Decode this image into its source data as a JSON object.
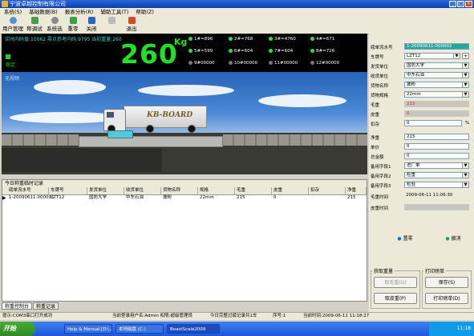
{
  "window": {
    "title": "宁波卓越控制有限公司"
  },
  "menu": [
    "系统(S)",
    "基础数据(B)",
    "报表分析(R)",
    "辅助工具(T)",
    "帮助(Z)"
  ],
  "toolbar": [
    "用户管理",
    "称调试",
    "系统选项",
    "重零",
    "关闭",
    "",
    "退出"
  ],
  "display": {
    "info": "实时内码值:10062 零点参考内码:9795  当前重量:260",
    "weight": "260",
    "unit": "Kg",
    "stable": "稳定",
    "io": [
      {
        "label": "1#=896",
        "on": true
      },
      {
        "label": "2#=768",
        "on": true
      },
      {
        "label": "3#=4760",
        "on": true
      },
      {
        "label": "4#=671",
        "on": true
      },
      {
        "label": "5#=599",
        "on": true
      },
      {
        "label": "6#=604",
        "on": true
      },
      {
        "label": "7#=604",
        "on": true
      },
      {
        "label": "8#=726",
        "on": true
      },
      {
        "label": "9#00000",
        "on": false
      },
      {
        "label": "10#00000",
        "on": false
      },
      {
        "label": "11#00000",
        "on": false
      },
      {
        "label": "12#00000",
        "on": false
      }
    ]
  },
  "video": {
    "camera_label": "无视频",
    "truck_text": "KB-BOARD"
  },
  "records": {
    "title": "今日称重临时记录",
    "columns": [
      "磅单流水号",
      "车牌号",
      "发货单位",
      "收货单位",
      "货物名称",
      "规格",
      "毛重",
      "皮重",
      "扣杂",
      "净重"
    ],
    "rows": [
      [
        "1-20090611-000001",
        "LZT12",
        "国防大学",
        "中东石油",
        "玻粉",
        "22mm",
        "215",
        "0",
        "",
        "215"
      ]
    ]
  },
  "bottom_tabs": [
    "称重控制台",
    "称重记录"
  ],
  "statusbar": [
    "提示:COM3串口打开成功",
    "当前登录用户名:Admin 权限:超级管理员",
    "今日完整过磅记录共1车",
    "序号:1",
    "当前时间:2009-06-11 11:18:27"
  ],
  "taskbar": {
    "start": "开始",
    "tasks": [
      "Help & Manual [D:\\...",
      "本地磁盘 (C:)",
      "BoastScale2009"
    ],
    "clock": "11:18"
  },
  "form": {
    "serial_label": "磅单流水号",
    "serial": "1-20090611-000002",
    "plate_label": "车牌号",
    "plate": "LZT12",
    "plate_btn": "+",
    "sender_label": "发货单位",
    "sender": "国防大学",
    "receiver_label": "收货单位",
    "receiver": "中东石油",
    "goods_label": "货物名称",
    "goods": "玻粉",
    "spec_label": "货物规格",
    "spec": "22mm",
    "gross_label": "毛重",
    "gross": "215",
    "tare_label": "皮重",
    "tare": "0",
    "deduct_label": "扣杂",
    "deduct": "0",
    "deduct_unit": "%",
    "net_label": "净重",
    "net": "215",
    "price_label": "单价",
    "price": "0",
    "amount_label": "总金额",
    "amount": "0",
    "memo1_label": "备用字段1",
    "memo1": "进厂单",
    "memo2_label": "备用字段2",
    "memo2": "检重",
    "memo3_label": "备用字段3",
    "memo3": "检验",
    "gross_time_label": "毛重时间",
    "gross_time": "2009-06-11 11:06:30",
    "tare_time_label": "皮重时间",
    "tare_time": "",
    "save_btn": "置零",
    "clear_btn": "撤消",
    "fetch_group": "获取重量",
    "fetch_gross": "取毛重(G)",
    "fetch_tare": "取皮重(P)",
    "print_group": "打印磅单",
    "save_record": "保存(S)",
    "print_ticket": "打印磅单(D)"
  },
  "colors": {
    "display_bg": "#000000",
    "weight_digits": "#22e022",
    "taskbar": "#245edb",
    "serial_field": "#25a89b"
  }
}
